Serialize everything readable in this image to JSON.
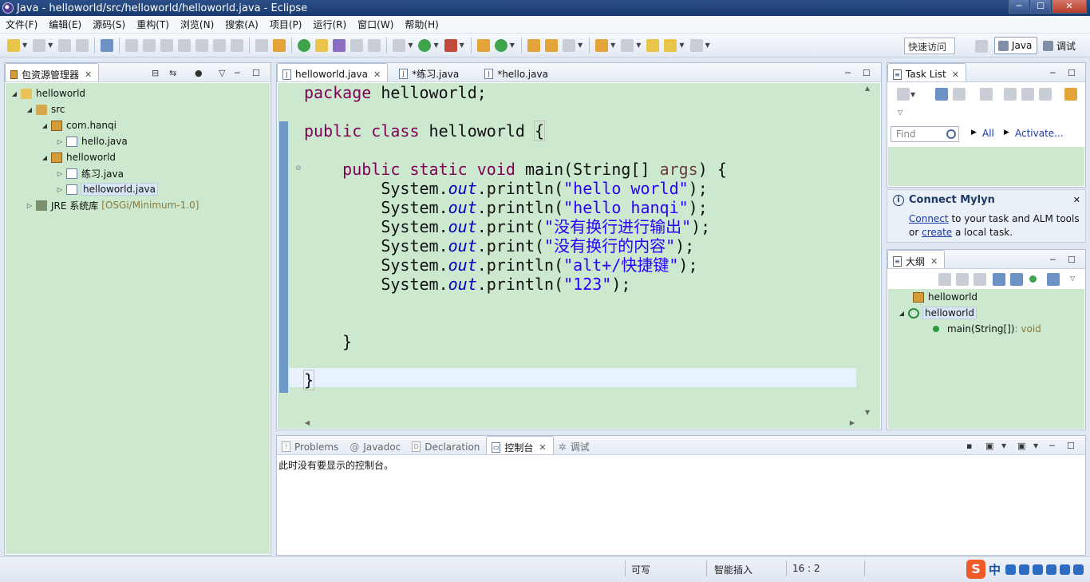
{
  "window": {
    "title": "Java - helloworld/src/helloworld/helloworld.java - Eclipse",
    "buttons": [
      "─",
      "☐",
      "✕"
    ]
  },
  "menubar": [
    "文件(F)",
    "编辑(E)",
    "源码(S)",
    "重构(T)",
    "浏览(N)",
    "搜索(A)",
    "项目(P)",
    "运行(R)",
    "窗口(W)",
    "帮助(H)"
  ],
  "toolbar": {
    "quick_access": "快速访问",
    "perspective_java": "Java",
    "perspective_debug": "调试"
  },
  "explorer": {
    "tab": "包资源管理器",
    "tree": [
      {
        "label": "helloworld",
        "depth": 0,
        "icon": "project-icon",
        "expanded": true
      },
      {
        "label": "src",
        "depth": 1,
        "icon": "source-folder-icon",
        "expanded": true
      },
      {
        "label": "com.hanqi",
        "depth": 2,
        "icon": "package-icon",
        "expanded": true
      },
      {
        "label": "hello.java",
        "depth": 3,
        "icon": "java-file-icon",
        "expanded": false
      },
      {
        "label": "helloworld",
        "depth": 2,
        "icon": "package-icon",
        "expanded": true
      },
      {
        "label": "练习.java",
        "depth": 3,
        "icon": "java-file-icon",
        "expanded": false
      },
      {
        "label": "helloworld.java",
        "depth": 3,
        "icon": "java-file-icon",
        "expanded": false,
        "selected": true
      },
      {
        "label": "JRE 系统库",
        "decoration": "[OSGi/Minimum-1.0]",
        "depth": 1,
        "icon": "library-icon",
        "expanded": false
      }
    ]
  },
  "editor": {
    "tabs": [
      "helloworld.java",
      "*练习.java",
      "*hello.java"
    ],
    "lines": [
      [
        [
          "kw",
          "package"
        ],
        [
          "t",
          " helloworld;"
        ]
      ],
      [],
      [
        [
          "kw",
          "public"
        ],
        [
          "t",
          " "
        ],
        [
          "kw",
          "class"
        ],
        [
          "t",
          " helloworld "
        ],
        [
          "brk",
          "{"
        ]
      ],
      [],
      [
        [
          "t",
          "    "
        ],
        [
          "kw",
          "public"
        ],
        [
          "t",
          " "
        ],
        [
          "kw",
          "static"
        ],
        [
          "t",
          " "
        ],
        [
          "kw",
          "void"
        ],
        [
          "t",
          " main(String[] "
        ],
        [
          "arg",
          "args"
        ],
        [
          "t",
          ") {"
        ]
      ],
      [
        [
          "t",
          "        System."
        ],
        [
          "field",
          "out"
        ],
        [
          "t",
          ".println("
        ],
        [
          "str",
          "\"hello world\""
        ],
        [
          "t",
          ");"
        ]
      ],
      [
        [
          "t",
          "        System."
        ],
        [
          "field",
          "out"
        ],
        [
          "t",
          ".println("
        ],
        [
          "str",
          "\"hello hanqi\""
        ],
        [
          "t",
          ");"
        ]
      ],
      [
        [
          "t",
          "        System."
        ],
        [
          "field",
          "out"
        ],
        [
          "t",
          ".print("
        ],
        [
          "str",
          "\"没有换行进行输出\""
        ],
        [
          "t",
          ");"
        ]
      ],
      [
        [
          "t",
          "        System."
        ],
        [
          "field",
          "out"
        ],
        [
          "t",
          ".print("
        ],
        [
          "str",
          "\"没有换行的内容\""
        ],
        [
          "t",
          ");"
        ]
      ],
      [
        [
          "t",
          "        System."
        ],
        [
          "field",
          "out"
        ],
        [
          "t",
          ".println("
        ],
        [
          "str",
          "\"alt+/快捷键\""
        ],
        [
          "t",
          ");"
        ]
      ],
      [
        [
          "t",
          "        System."
        ],
        [
          "field",
          "out"
        ],
        [
          "t",
          ".println("
        ],
        [
          "str",
          "\"123\""
        ],
        [
          "t",
          ");"
        ]
      ],
      [],
      [],
      [
        [
          "t",
          "    }"
        ]
      ],
      [],
      [
        [
          "brk",
          "}"
        ]
      ]
    ]
  },
  "tasklist": {
    "tab": "Task List",
    "find_placeholder": "Find",
    "all_label": "All",
    "activate_label": "Activate..."
  },
  "mylyn": {
    "title": "Connect Mylyn",
    "connect_link": "Connect",
    "text1": " to your task and ALM tools",
    "text2": "or ",
    "create_link": "create",
    "text3": " a local task."
  },
  "outline": {
    "tab": "大纲",
    "items": [
      {
        "label": "helloworld",
        "icon": "package-icon",
        "depth": 0
      },
      {
        "label": "helloworld",
        "icon": "class-icon",
        "depth": 0,
        "expanded": true
      },
      {
        "label": "main(String[])",
        "type": " : void",
        "icon": "method-icon",
        "depth": 1
      }
    ]
  },
  "console": {
    "tabs": [
      "Problems",
      "Javadoc",
      "Declaration",
      "控制台",
      "调试"
    ],
    "message": "此时没有要显示的控制台。"
  },
  "statusbar": {
    "writable": "可写",
    "insert_mode": "智能插入",
    "position": "16 : 2"
  },
  "ime": {
    "logo": "S",
    "lang": "中"
  },
  "colors": {
    "editor_bg": "#cce8cf",
    "keyword": "#7f0055",
    "string": "#2a00ff",
    "field": "#0000c0"
  }
}
